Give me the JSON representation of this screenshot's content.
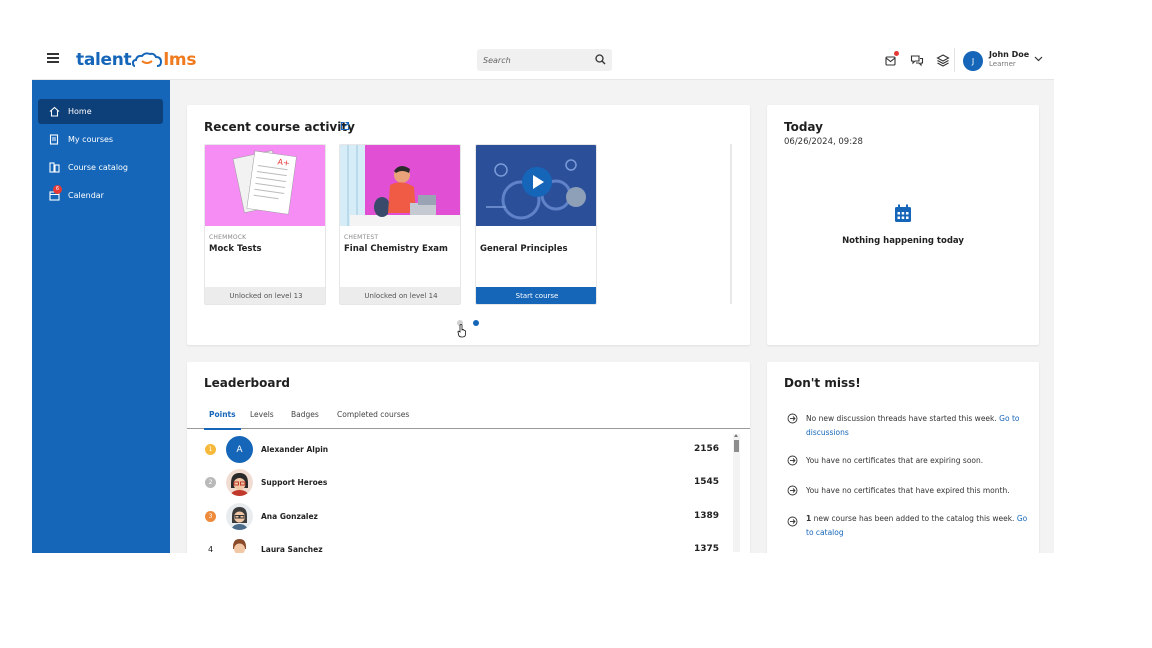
{
  "header": {
    "logo_left": "talent",
    "logo_right": "lms",
    "search_placeholder": "Search",
    "user_initial": "J",
    "user_name": "John Doe",
    "user_role": "Learner"
  },
  "sidebar": {
    "items": [
      {
        "label": "Home",
        "icon": "home-icon"
      },
      {
        "label": "My courses",
        "icon": "book-icon"
      },
      {
        "label": "Course catalog",
        "icon": "catalog-icon"
      },
      {
        "label": "Calendar",
        "icon": "calendar-icon",
        "badge": "6"
      }
    ]
  },
  "recent": {
    "title": "Recent course activity",
    "courses": [
      {
        "code": "CHEMMOCK",
        "name": "Mock Tests",
        "footer": "Unlocked on level 13"
      },
      {
        "code": "CHEMTEST",
        "name": "Final Chemistry Exam",
        "footer": "Unlocked on level 14"
      },
      {
        "code": "",
        "name": "General Principles",
        "footer": "Start course"
      }
    ]
  },
  "today": {
    "title": "Today",
    "datetime": "06/26/2024, 09:28",
    "empty_text": "Nothing happening today"
  },
  "leaderboard": {
    "title": "Leaderboard",
    "tabs": [
      "Points",
      "Levels",
      "Badges",
      "Completed courses"
    ],
    "rows": [
      {
        "rank": "1",
        "name": "Alexander Alpin",
        "points": "2156",
        "initial": "A"
      },
      {
        "rank": "2",
        "name": "Support Heroes",
        "points": "1545"
      },
      {
        "rank": "3",
        "name": "Ana Gonzalez",
        "points": "1389"
      },
      {
        "rank": "4",
        "name": "Laura Sanchez",
        "points": "1375"
      }
    ]
  },
  "dontmiss": {
    "title": "Don't miss!",
    "item1_text": "No new discussion threads have started this week.",
    "item1_link": "Go to discussions",
    "item2_text": "You have no certificates that are expiring soon.",
    "item3_text": "You have no certificates that have expired this month.",
    "item4_count": "1",
    "item4_text": "new course has been added to the catalog this week.",
    "item4_link": "Go to catalog"
  },
  "colors": {
    "brand_blue": "#1565b8",
    "brand_orange": "#f07b1e",
    "sidebar_active": "#0d3f78",
    "gold": "#f6b93b",
    "silver": "#b9b9b9",
    "bronze": "#ee8a3b"
  }
}
